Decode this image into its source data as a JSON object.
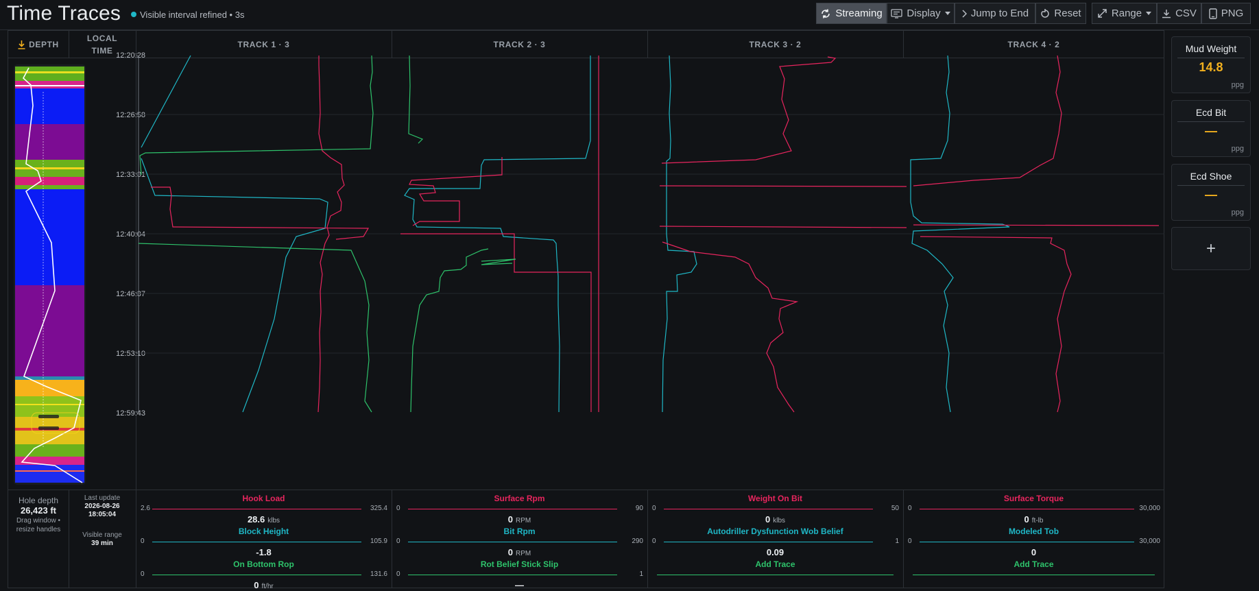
{
  "header": {
    "title": "Time Traces",
    "status_text": "Visible interval refined • 3s",
    "buttons": {
      "streaming": "Streaming",
      "display": "Display",
      "jump_to_end": "Jump to End",
      "reset": "Reset",
      "range": "Range",
      "csv": "CSV",
      "png": "PNG"
    }
  },
  "columns": {
    "depth": "DEPTH",
    "time_line1": "LOCAL",
    "time_line2": "TIME",
    "tracks": [
      "TRACK 1 · 3",
      "TRACK 2 · 3",
      "TRACK 3 · 2",
      "TRACK 4 · 2"
    ]
  },
  "time_ticks": [
    "12:20:28",
    "12:26:58",
    "12:33:31",
    "12:40:04",
    "12:46:37",
    "12:53:10",
    "12:59:43"
  ],
  "footer": {
    "hole_depth_label": "Hole depth",
    "hole_depth_value": "26,423 ft",
    "drag_hint_line1": "Drag window •",
    "drag_hint_line2": "resize handles",
    "last_update_label": "Last update",
    "last_update_date": "2026-08-26",
    "last_update_time": "18:05:04",
    "visible_range_label": "Visible range",
    "visible_range_value": "39 min",
    "tracks": [
      [
        {
          "name": "Hook Load",
          "min": "2.6",
          "max": "325.4",
          "value": "28.6",
          "unit": "klbs",
          "color": "#e8255e"
        },
        {
          "name": "Block Height",
          "min": "0",
          "max": "105.9",
          "value": "-1.8",
          "unit": "",
          "color": "#1fb7c6"
        },
        {
          "name": "On Bottom Rop",
          "min": "0",
          "max": "131.6",
          "value": "0",
          "unit": "ft/hr",
          "color": "#2ec36b"
        }
      ],
      [
        {
          "name": "Surface Rpm",
          "min": "0",
          "max": "90",
          "value": "0",
          "unit": "RPM",
          "color": "#e8255e"
        },
        {
          "name": "Bit Rpm",
          "min": "0",
          "max": "290",
          "value": "0",
          "unit": "RPM",
          "color": "#1fb7c6"
        },
        {
          "name": "Rot Belief Stick Slip",
          "min": "0",
          "max": "1",
          "value": "—",
          "unit": "",
          "color": "#2ec36b"
        }
      ],
      [
        {
          "name": "Weight On Bit",
          "min": "0",
          "max": "50",
          "value": "0",
          "unit": "klbs",
          "color": "#e8255e"
        },
        {
          "name": "Autodriller Dysfunction Wob Belief",
          "min": "0",
          "max": "1",
          "value": "0.09",
          "unit": "",
          "color": "#1fb7c6"
        },
        {
          "name": "Add Trace",
          "min": "",
          "max": "",
          "value": "",
          "unit": "",
          "color": "#2ec36b"
        }
      ],
      [
        {
          "name": "Surface Torque",
          "min": "0",
          "max": "30,000",
          "value": "0",
          "unit": "ft-lb",
          "color": "#e8255e"
        },
        {
          "name": "Modeled Tob",
          "min": "0",
          "max": "30,000",
          "value": "0",
          "unit": "",
          "color": "#1fb7c6"
        },
        {
          "name": "Add Trace",
          "min": "",
          "max": "",
          "value": "",
          "unit": "",
          "color": "#2ec36b"
        }
      ]
    ]
  },
  "cards": [
    {
      "title": "Mud Weight",
      "value": "14.8",
      "unit": "ppg"
    },
    {
      "title": "Ecd Bit",
      "value": "—",
      "unit": "ppg"
    },
    {
      "title": "Ecd Shoe",
      "value": "—",
      "unit": "ppg"
    }
  ],
  "add_card_label": "+",
  "colors": {
    "red_trace": "#e8255e",
    "cyan_trace": "#1fb7c6",
    "green_trace": "#2ec36b",
    "accent_orange": "#f2b01e",
    "background": "#121417"
  },
  "icons": {
    "streaming": "refresh-icon",
    "display": "display-icon",
    "jump": "chevron-right-icon",
    "reset": "reset-icon",
    "range": "expand-icon",
    "csv": "download-icon",
    "png": "phone-icon",
    "depth": "download-arrow-icon"
  }
}
